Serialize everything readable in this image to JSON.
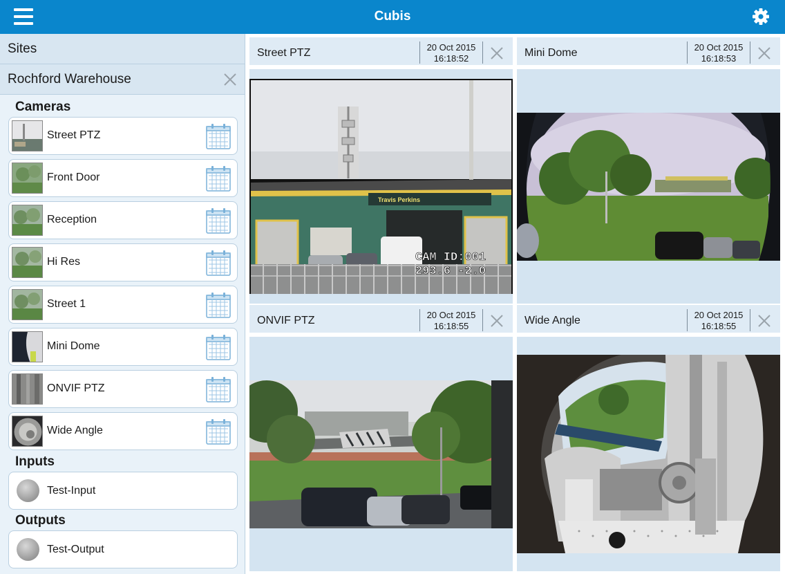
{
  "header": {
    "title": "Cubis",
    "menu_icon": "hamburger-icon",
    "settings_icon": "gear-icon"
  },
  "sidebar": {
    "sites_label": "Sites",
    "site_name": "Rochford Warehouse",
    "cameras_heading": "Cameras",
    "cameras": [
      {
        "label": "Street PTZ"
      },
      {
        "label": "Front Door"
      },
      {
        "label": "Reception"
      },
      {
        "label": "Hi Res"
      },
      {
        "label": "Street 1"
      },
      {
        "label": "Mini Dome"
      },
      {
        "label": "ONVIF PTZ"
      },
      {
        "label": "Wide Angle"
      }
    ],
    "inputs_heading": "Inputs",
    "inputs": [
      {
        "label": "Test-Input"
      }
    ],
    "outputs_heading": "Outputs",
    "outputs": [
      {
        "label": "Test-Output"
      }
    ]
  },
  "panels": [
    {
      "title": "Street PTZ",
      "date": "20 Oct 2015",
      "time": "16:18:52",
      "overlay_line1": "CAM ID:001",
      "overlay_line2": "293.6 -2.0",
      "sign_text": "Travis Perkins"
    },
    {
      "title": "Mini Dome",
      "date": "20 Oct 2015",
      "time": "16:18:53"
    },
    {
      "title": "ONVIF PTZ",
      "date": "20 Oct 2015",
      "time": "16:18:55"
    },
    {
      "title": "Wide Angle",
      "date": "20 Oct 2015",
      "time": "16:18:55"
    }
  ],
  "colors": {
    "accent": "#0a86cc",
    "sidebar_bg": "#e9f2f9",
    "panel_bg": "#d4e4f1"
  }
}
